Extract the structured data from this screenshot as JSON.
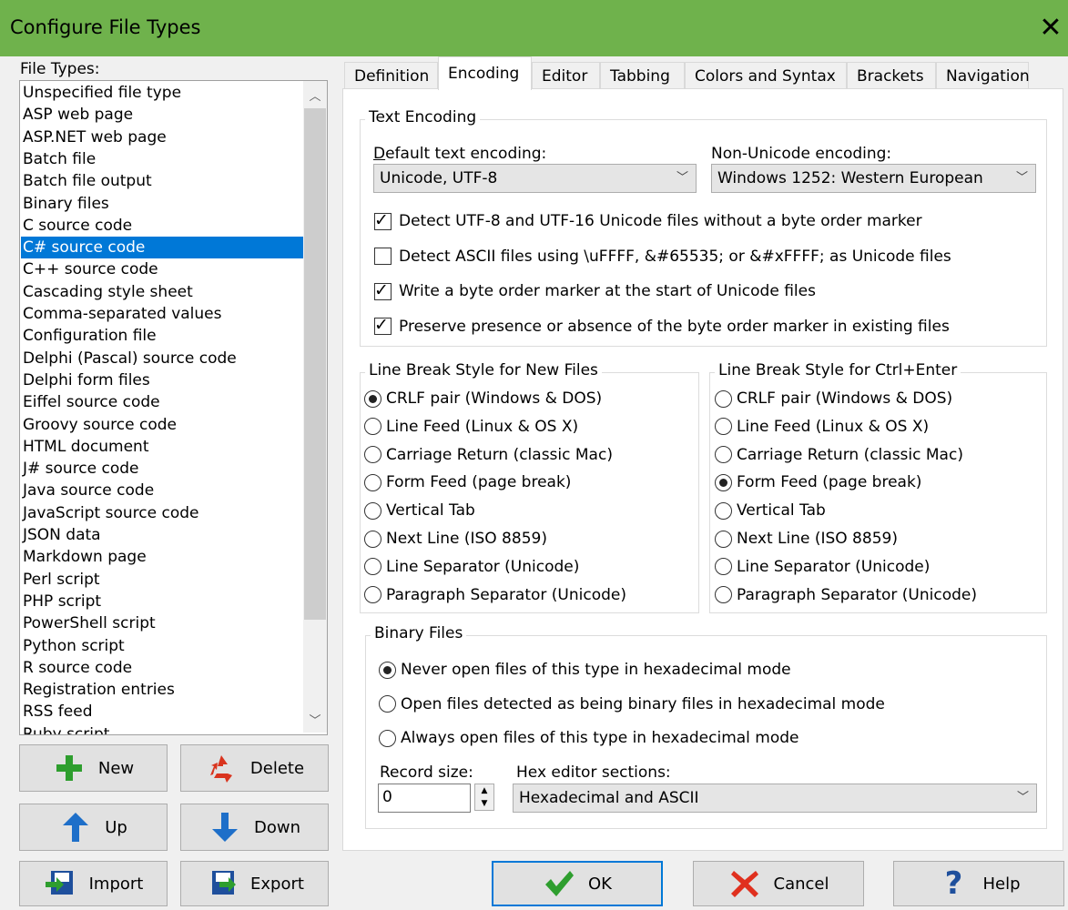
{
  "window": {
    "title": "Configure File Types",
    "close": "✕"
  },
  "file_types": {
    "label": "File Types:",
    "items": [
      "Unspecified file type",
      "ASP web page",
      "ASP.NET web page",
      "Batch file",
      "Batch file output",
      "Binary files",
      "C source code",
      "C# source code",
      "C++ source code",
      "Cascading style sheet",
      "Comma-separated values",
      "Configuration file",
      "Delphi (Pascal) source code",
      "Delphi form files",
      "Eiffel source code",
      "Groovy source code",
      "HTML document",
      "J# source code",
      "Java source code",
      "JavaScript source code",
      "JSON data",
      "Markdown page",
      "Perl script",
      "PHP script",
      "PowerShell script",
      "Python script",
      "R source code",
      "Registration entries",
      "RSS feed",
      "Ruby script"
    ],
    "selected": "C# source code"
  },
  "buttons": {
    "new": "New",
    "delete": "Delete",
    "up": "Up",
    "down": "Down",
    "import": "Import",
    "export": "Export",
    "ok": "OK",
    "cancel": "Cancel",
    "help": "Help"
  },
  "tabs": [
    "Definition",
    "Encoding",
    "Editor",
    "Tabbing",
    "Colors and Syntax",
    "Brackets",
    "Navigation"
  ],
  "active_tab": "Encoding",
  "text_encoding": {
    "title": "Text Encoding",
    "default_label": "Default text encoding:",
    "default_value": "Unicode, UTF-8",
    "nonunicode_label": "Non-Unicode encoding:",
    "nonunicode_value": "Windows 1252: Western European",
    "checks": [
      {
        "label": "Detect UTF-8 and UTF-16 Unicode files without a byte order marker",
        "checked": true
      },
      {
        "label": "Detect ASCII files using \\uFFFF, &#65535; or &#xFFFF; as Unicode files",
        "checked": false
      },
      {
        "label": "Write a byte order marker at the start of Unicode files",
        "checked": true
      },
      {
        "label": "Preserve presence or absence of the byte order marker in existing files",
        "checked": true
      }
    ]
  },
  "line_break_new": {
    "title": "Line Break Style for New Files",
    "options": [
      "CRLF pair (Windows & DOS)",
      "Line Feed (Linux & OS X)",
      "Carriage Return (classic Mac)",
      "Form Feed (page break)",
      "Vertical Tab",
      "Next Line (ISO 8859)",
      "Line Separator (Unicode)",
      "Paragraph Separator (Unicode)"
    ],
    "selected": "CRLF pair (Windows & DOS)"
  },
  "line_break_ctrl": {
    "title": "Line Break Style for Ctrl+Enter",
    "options": [
      "CRLF pair (Windows & DOS)",
      "Line Feed (Linux & OS X)",
      "Carriage Return (classic Mac)",
      "Form Feed (page break)",
      "Vertical Tab",
      "Next Line (ISO 8859)",
      "Line Separator (Unicode)",
      "Paragraph Separator (Unicode)"
    ],
    "selected": "Form Feed (page break)"
  },
  "binary_files": {
    "title": "Binary Files",
    "options": [
      "Never open files of this type in hexadecimal mode",
      "Open files detected as being binary files in hexadecimal mode",
      "Always open files of this type in hexadecimal mode"
    ],
    "selected": "Never open files of this type in hexadecimal mode",
    "record_label": "Record size:",
    "record_value": "0",
    "hex_label": "Hex editor sections:",
    "hex_value": "Hexadecimal and ASCII"
  },
  "colors": {
    "titlebar": "#6fb24c",
    "selection": "#0078d7",
    "new_icon": "#2e9e2e",
    "delete_icon": "#d9341e",
    "arrow_icon": "#1e6fc9",
    "cancel_icon": "#e0301e",
    "ok_icon": "#2e9e2e",
    "help_icon": "#1e4f9c"
  }
}
